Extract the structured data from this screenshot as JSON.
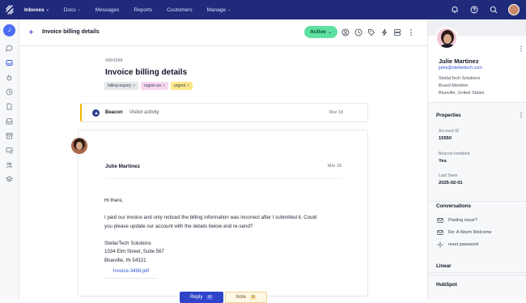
{
  "topbar": {
    "nav": [
      {
        "label": "Inboxes",
        "caret": "⌄",
        "active": true
      },
      {
        "label": "Docs",
        "caret": "⌄"
      },
      {
        "label": "Messages"
      },
      {
        "label": "Reports"
      },
      {
        "label": "Customers"
      },
      {
        "label": "Manage",
        "caret": "⌄"
      }
    ]
  },
  "rail": {
    "user_initial": "J"
  },
  "conversation": {
    "header_title": "Invoice billing details",
    "status_label": "Active",
    "status_caret": "⌄",
    "ticket_id": "#864398",
    "subject": "Invoice billing details",
    "tags": [
      {
        "label": "billing-inquiry",
        "color": "#e5e7eb"
      },
      {
        "label": "region-us",
        "color": "#f6d6ef"
      },
      {
        "label": "urgent",
        "color": "#fde68a"
      }
    ],
    "tag_remove": "×",
    "event": {
      "source": "Beacon",
      "description": "Visitor activity",
      "date": "Mar 18"
    },
    "message": {
      "author": "Julie Martinez",
      "date": "Mar 18",
      "greeting": "Hi there,",
      "body_lines": [
        "I paid our invoice and only noticed the billing information was  incorrect after I submitted it. Could",
        "you please update our account with the details below and re-send?"
      ],
      "address_lines": [
        "StellarTech Solutions",
        "1034 Elm Street, Suite 567",
        "Blueville, IN 54321"
      ],
      "attachment": "Invoice-3488.pdf"
    },
    "reply_label": "Reply",
    "reply_shortcut": "R",
    "note_label": "Note",
    "note_shortcut": "N"
  },
  "sidebar": {
    "profile": {
      "name": "Julie Martinez",
      "email": "jules@stellartech.com",
      "company": "StellarTech Solutions",
      "title": "Board Member",
      "location": "Blueville, United States"
    },
    "properties": {
      "heading": "Properties",
      "items": [
        {
          "label": "Account ID",
          "value": "15550"
        },
        {
          "label": "Beacon Installed",
          "value": "Yes"
        },
        {
          "label": "Last Seen",
          "value": "2025-02-01"
        }
      ]
    },
    "conversations": {
      "heading": "Conversations",
      "items": [
        {
          "label": "Pasting issue?",
          "icon": "envelope-icon"
        },
        {
          "label": "Re: A Warm Welcome",
          "icon": "envelope-icon"
        },
        {
          "label": "reset password",
          "icon": "sparkle-icon"
        }
      ]
    },
    "integrations": [
      "Linear",
      "HubSpot"
    ]
  },
  "colors": {
    "topbar": "#1f2a7a",
    "status_active": "#5ee0a0",
    "reply": "#2f44c9",
    "link": "#2f55d4",
    "event_accent": "#f4b400"
  }
}
